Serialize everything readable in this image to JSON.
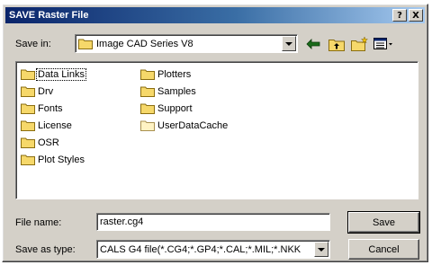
{
  "dialog": {
    "title": "SAVE Raster File",
    "help_button": "?",
    "close_button": "X"
  },
  "lookin": {
    "label": "Save in:",
    "value": "Image CAD Series V8"
  },
  "toolbar": {
    "icons": [
      "back-arrow-icon",
      "up-folder-icon",
      "new-folder-icon",
      "view-menu-icon"
    ]
  },
  "files": {
    "column1": [
      "Data Links",
      "Drv",
      "Fonts",
      "License",
      "OSR",
      "Plot Styles"
    ],
    "column2": [
      "Plotters",
      "Samples",
      "Support",
      "UserDataCache"
    ]
  },
  "filename": {
    "label": "File name:",
    "value": "raster.cg4"
  },
  "saveastype": {
    "label": "Save as type:",
    "value": "CALS G4 file(*.CG4;*.GP4;*.CAL;*.MIL;*.NKK"
  },
  "buttons": {
    "save": "Save",
    "cancel": "Cancel"
  },
  "colors": {
    "titlebar_start": "#0a246a",
    "titlebar_end": "#a6caf0",
    "face": "#d4d0c8",
    "folder": "#f6d86a"
  }
}
